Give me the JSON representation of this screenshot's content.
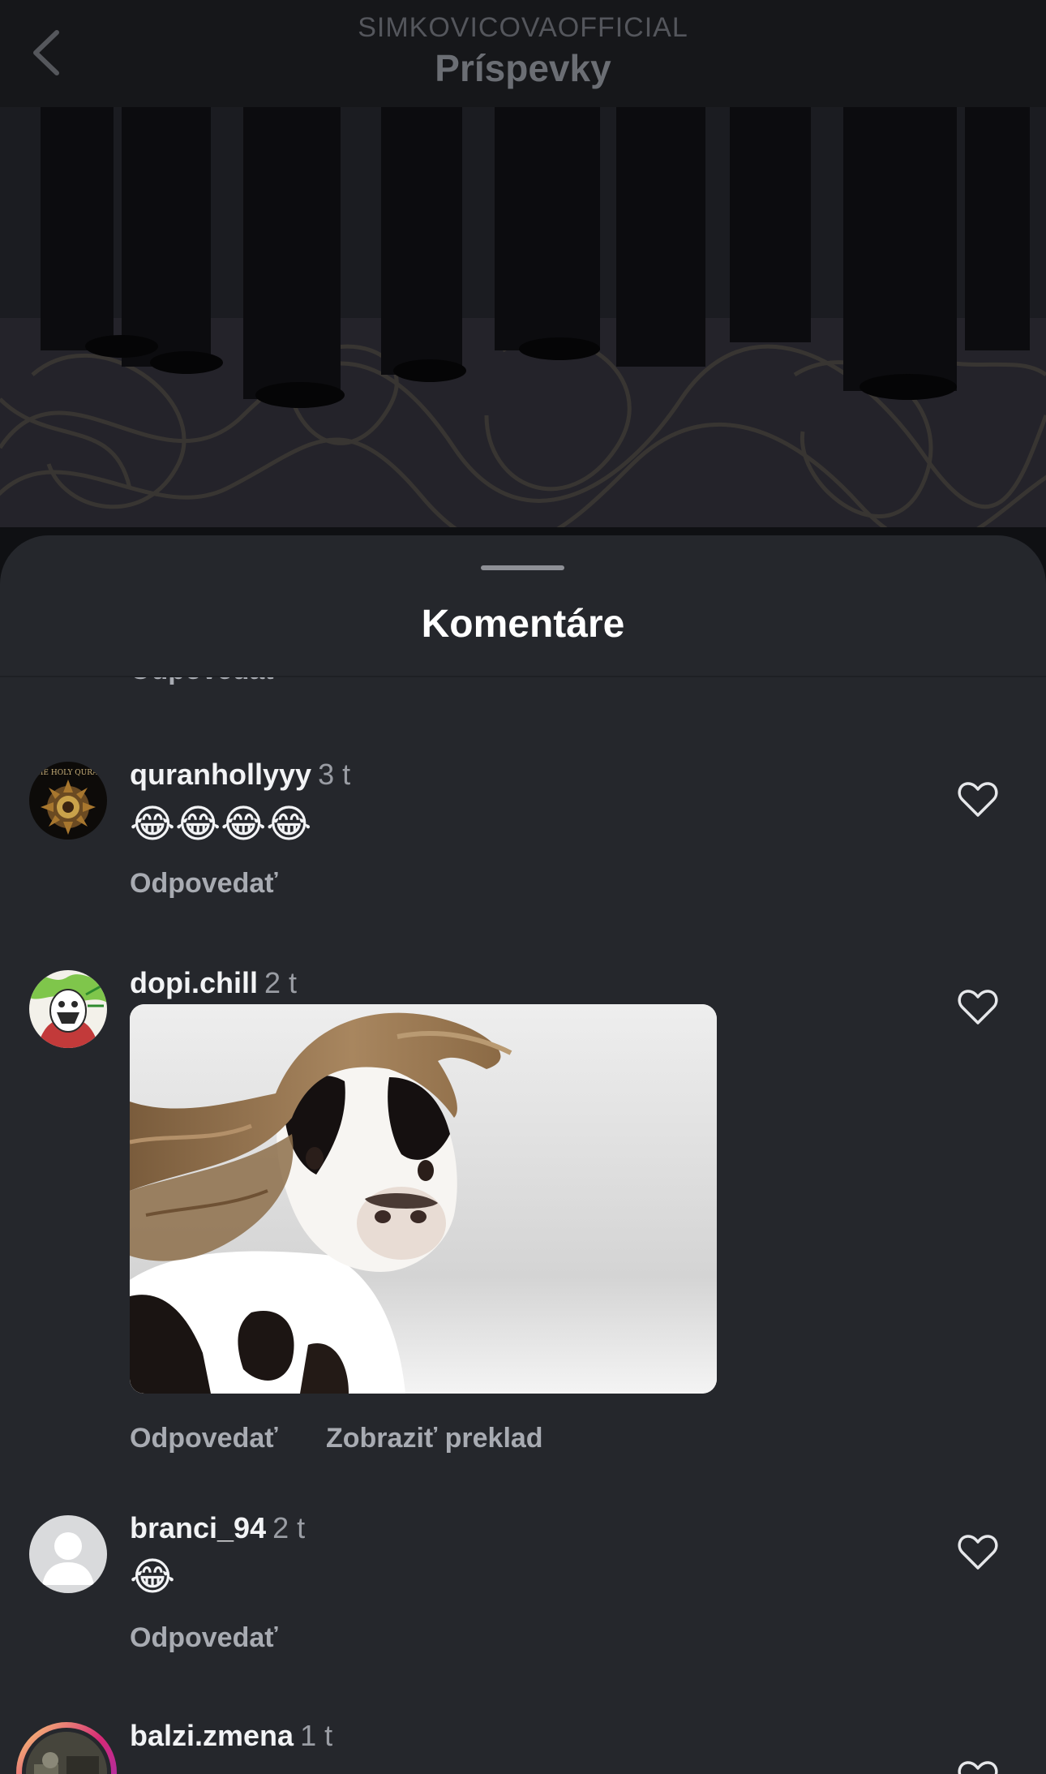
{
  "header": {
    "account_name": "SIMKOVICOVAOFFICIAL",
    "title": "Príspevky",
    "back_icon": "chevron-left-icon"
  },
  "sheet": {
    "title": "Komentáre",
    "cut_reply_label": "Odpovedať"
  },
  "comments": [
    {
      "username": "quranhollyyy",
      "time": "3 t",
      "text": "😂😂😂😂",
      "reply_label": "Odpovedať",
      "avatar_text": "THE HOLY QURAN",
      "like_icon": "heart-outline-icon"
    },
    {
      "username": "dopi.chill",
      "time": "2 t",
      "media": "cow-with-hair-gif",
      "reply_label": "Odpovedať",
      "translate_label": "Zobraziť preklad",
      "like_icon": "heart-outline-icon"
    },
    {
      "username": "branci_94",
      "time": "2 t",
      "text": "😂",
      "reply_label": "Odpovedať",
      "like_icon": "heart-outline-icon"
    },
    {
      "username": "balzi.zmena",
      "time": "1 t",
      "like_icon": "heart-outline-icon"
    }
  ],
  "colors": {
    "sheet_bg": "#25272c",
    "topbar_bg": "#16171a",
    "secondary_text": "#a8abb2",
    "story_ring": "#d62976"
  }
}
